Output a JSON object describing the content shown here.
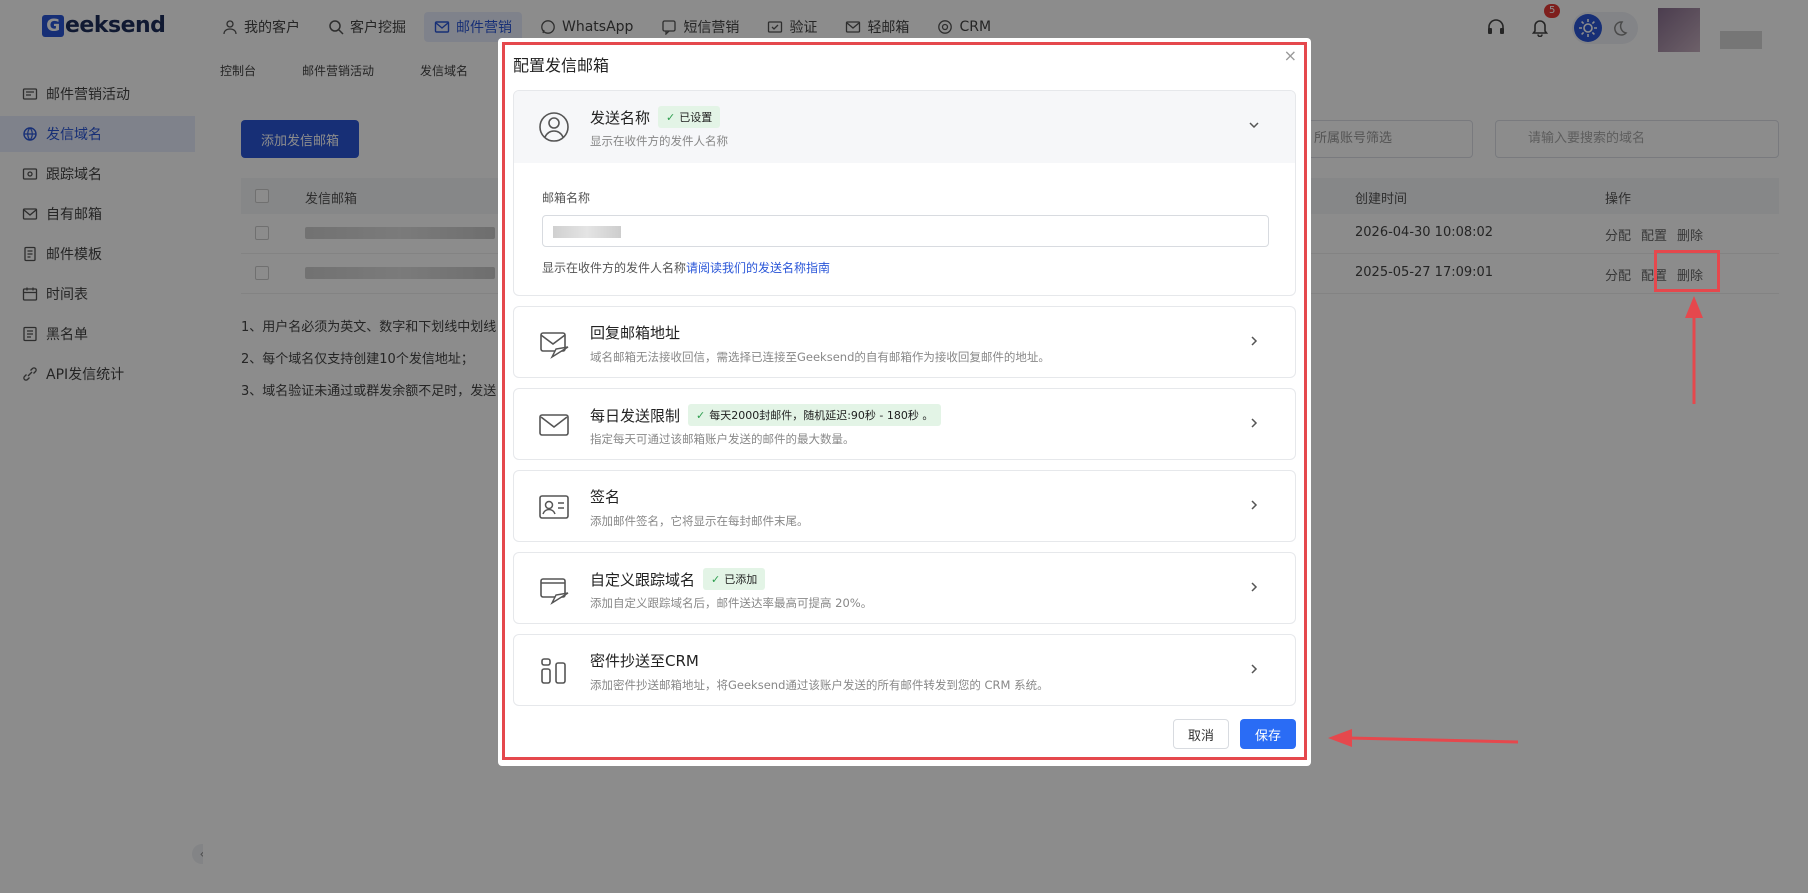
{
  "header": {
    "logo_text": "eeksend",
    "logo_letter": "G",
    "nav": [
      {
        "label": "我的客户",
        "icon": "user-icon"
      },
      {
        "label": "客户挖掘",
        "icon": "search-icon"
      },
      {
        "label": "邮件营销",
        "icon": "mail-icon",
        "active": true
      },
      {
        "label": "WhatsApp",
        "icon": "whatsapp-icon"
      },
      {
        "label": "短信营销",
        "icon": "sms-icon"
      },
      {
        "label": "验证",
        "icon": "verify-icon"
      },
      {
        "label": "轻邮箱",
        "icon": "light-mail-icon"
      },
      {
        "label": "CRM",
        "icon": "crm-icon"
      }
    ],
    "notification_count": "5"
  },
  "subnav": [
    "控制台",
    "邮件营销活动",
    "发信域名"
  ],
  "sidebar": {
    "items": [
      {
        "label": "邮件营销活动",
        "icon": "campaign-icon"
      },
      {
        "label": "发信域名",
        "icon": "globe-icon",
        "active": true
      },
      {
        "label": "跟踪域名",
        "icon": "tracking-icon"
      },
      {
        "label": "自有邮箱",
        "icon": "mailbox-icon"
      },
      {
        "label": "邮件模板",
        "icon": "template-icon"
      },
      {
        "label": "时间表",
        "icon": "calendar-icon"
      },
      {
        "label": "黑名单",
        "icon": "blacklist-icon"
      },
      {
        "label": "API发信统计",
        "icon": "api-icon"
      }
    ],
    "collapse_glyph": "‹"
  },
  "main": {
    "add_button": "添加发信邮箱",
    "filter_placeholder": "所属账号筛选",
    "search_placeholder": "请输入要搜索的域名",
    "columns": {
      "mailbox": "发信邮箱",
      "created": "创建时间",
      "ops": "操作"
    },
    "rows": [
      {
        "created": "2026-04-30 10:08:02"
      },
      {
        "created": "2025-05-27 17:09:01"
      }
    ],
    "ops": {
      "assign": "分配",
      "config": "配置",
      "delete": "删除"
    },
    "notes": [
      "1、用户名必须为英文、数字和下划线中划线",
      "2、每个域名仅支持创建10个发信地址；",
      "3、域名验证未通过或群发余额不足时，发送"
    ]
  },
  "modal": {
    "title": "配置发信邮箱",
    "close": "×",
    "sections": [
      {
        "title": "发送名称",
        "tag": "已设置",
        "desc": "显示在收件方的发件人名称",
        "icon": "user-circle-icon",
        "expanded": true,
        "field_label": "邮箱名称",
        "help_text": "显示在收件方的发件人名称",
        "help_link": "请阅读我们的发送名称指南"
      },
      {
        "title": "回复邮箱地址",
        "desc": "域名邮箱无法接收回信，需选择已连接至Geeksend的自有邮箱作为接收回复邮件的地址。",
        "icon": "reply-mail-icon"
      },
      {
        "title": "每日发送限制",
        "tag": "每天2000封邮件，随机延迟:90秒 - 180秒 。",
        "desc": "指定每天可通过该邮箱账户发送的邮件的最大数量。",
        "icon": "envelope-icon"
      },
      {
        "title": "签名",
        "desc": "添加邮件签名，它将显示在每封邮件末尾。",
        "icon": "id-card-icon"
      },
      {
        "title": "自定义跟踪域名",
        "tag": "已添加",
        "desc": "添加自定义跟踪域名后，邮件送达率最高可提高 20%。",
        "icon": "tracking-plane-icon"
      },
      {
        "title": "密件抄送至CRM",
        "desc": "添加密件抄送邮箱地址，将Geeksend通过该账户发送的所有邮件转发到您的 CRM 系统。",
        "icon": "crm-bcc-icon"
      }
    ],
    "cancel": "取消",
    "save": "保存"
  },
  "colors": {
    "primary": "#2a56d8",
    "save": "#2a6cf5",
    "annotation": "#e5484d",
    "tag_bg": "#e3f4e6"
  }
}
